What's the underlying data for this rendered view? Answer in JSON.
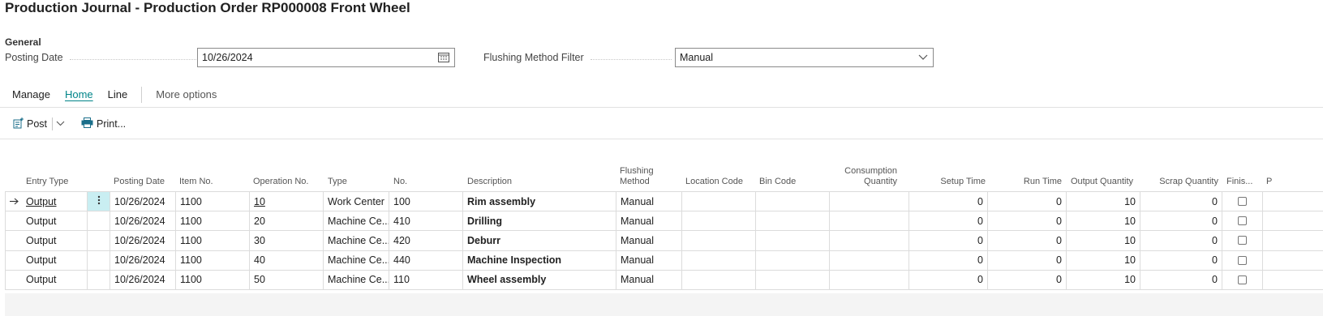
{
  "page": {
    "title": "Production Journal - Production Order RP000008 Front Wheel"
  },
  "general": {
    "section_label": "General",
    "posting_date_label": "Posting Date",
    "posting_date_value": "10/26/2024",
    "flushing_filter_label": "Flushing Method Filter",
    "flushing_filter_value": "Manual"
  },
  "actions": {
    "tabs": [
      "Manage",
      "Home",
      "Line"
    ],
    "active_tab": "Home",
    "more": "More options"
  },
  "toolbar": {
    "post_label": "Post",
    "print_label": "Print..."
  },
  "columns": {
    "entry_type": "Entry Type",
    "posting_date": "Posting Date",
    "item_no": "Item No.",
    "operation_no": "Operation No.",
    "type": "Type",
    "no": "No.",
    "description": "Description",
    "flushing_method_1": "Flushing",
    "flushing_method_2": "Method",
    "location_code": "Location Code",
    "bin_code": "Bin Code",
    "consumption_qty_1": "Consumption",
    "consumption_qty_2": "Quantity",
    "setup_time": "Setup Time",
    "run_time": "Run Time",
    "output_quantity": "Output Quantity",
    "scrap_quantity": "Scrap Quantity",
    "finished": "Finis...",
    "extra": "P"
  },
  "rows": [
    {
      "entry_type": "Output",
      "posting_date": "10/26/2024",
      "item_no": "1100",
      "operation_no": "10",
      "type": "Work Center",
      "no": "100",
      "description": "Rim assembly",
      "flushing_method": "Manual",
      "location_code": "",
      "bin_code": "",
      "consumption_qty": "",
      "setup_time": "0",
      "run_time": "0",
      "output_quantity": "10",
      "scrap_quantity": "0"
    },
    {
      "entry_type": "Output",
      "posting_date": "10/26/2024",
      "item_no": "1100",
      "operation_no": "20",
      "type": "Machine Ce...",
      "no": "410",
      "description": "Drilling",
      "flushing_method": "Manual",
      "location_code": "",
      "bin_code": "",
      "consumption_qty": "",
      "setup_time": "0",
      "run_time": "0",
      "output_quantity": "10",
      "scrap_quantity": "0"
    },
    {
      "entry_type": "Output",
      "posting_date": "10/26/2024",
      "item_no": "1100",
      "operation_no": "30",
      "type": "Machine Ce...",
      "no": "420",
      "description": "Deburr",
      "flushing_method": "Manual",
      "location_code": "",
      "bin_code": "",
      "consumption_qty": "",
      "setup_time": "0",
      "run_time": "0",
      "output_quantity": "10",
      "scrap_quantity": "0"
    },
    {
      "entry_type": "Output",
      "posting_date": "10/26/2024",
      "item_no": "1100",
      "operation_no": "40",
      "type": "Machine Ce...",
      "no": "440",
      "description": "Machine Inspection",
      "flushing_method": "Manual",
      "location_code": "",
      "bin_code": "",
      "consumption_qty": "",
      "setup_time": "0",
      "run_time": "0",
      "output_quantity": "10",
      "scrap_quantity": "0"
    },
    {
      "entry_type": "Output",
      "posting_date": "10/26/2024",
      "item_no": "1100",
      "operation_no": "50",
      "type": "Machine Ce...",
      "no": "110",
      "description": "Wheel assembly",
      "flushing_method": "Manual",
      "location_code": "",
      "bin_code": "",
      "consumption_qty": "",
      "setup_time": "0",
      "run_time": "0",
      "output_quantity": "10",
      "scrap_quantity": "0"
    }
  ],
  "colors": {
    "accent": "#008489",
    "selected_cell": "#c9eef2"
  },
  "icons": {
    "calendar": "calendar-icon",
    "dropdown": "chevron-down-icon",
    "post": "post-icon",
    "print": "printer-icon",
    "row_indicator": "arrow-right-icon",
    "row_menu": "more-vertical-icon"
  }
}
